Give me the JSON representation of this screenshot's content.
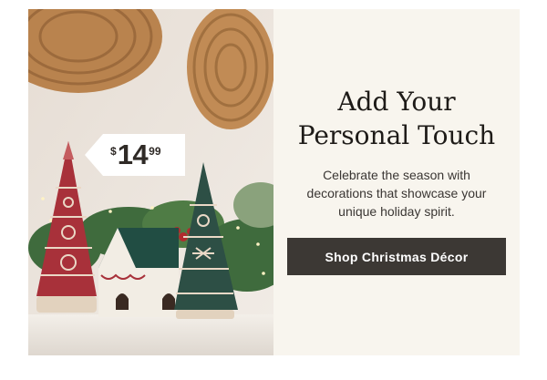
{
  "promo": {
    "price": {
      "currency": "$",
      "dollars": "14",
      "cents": "99"
    },
    "headline_line1": "Add Your",
    "headline_line2": "Personal Touch",
    "body": "Celebrate the season with decorations that showcase your unique holiday spirit.",
    "cta_label": "Shop Christmas Décor"
  },
  "colors": {
    "panel_bg": "#f8f5ee",
    "button_bg": "#3c3834",
    "button_text": "#ffffff",
    "red_tree": "#a8313a",
    "green_tree": "#2d4f45"
  }
}
